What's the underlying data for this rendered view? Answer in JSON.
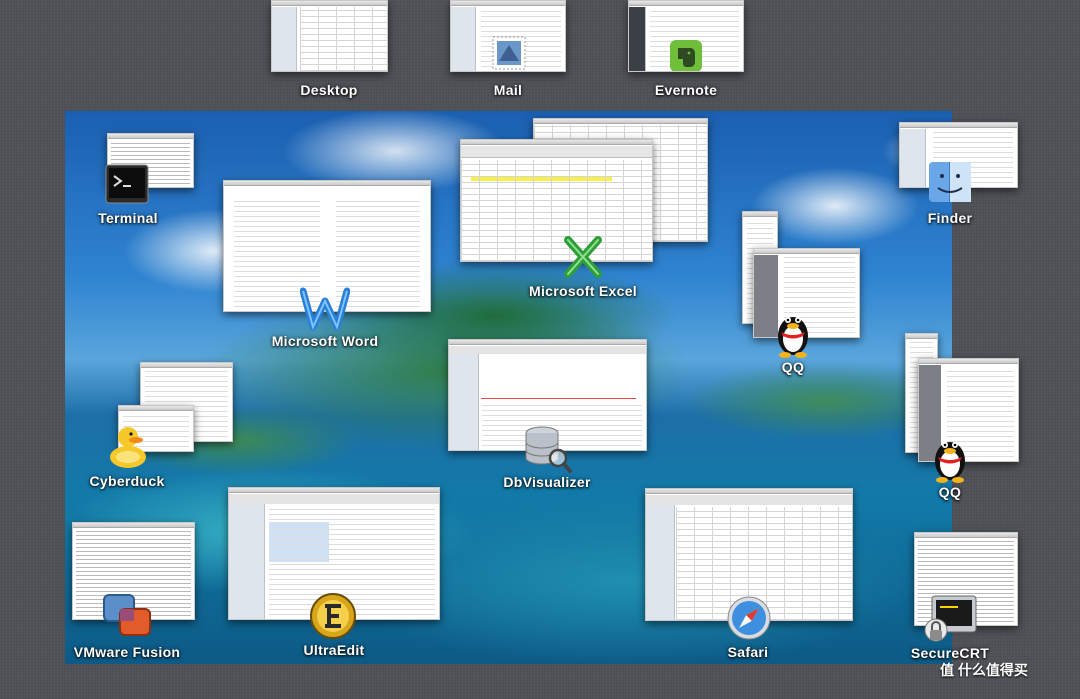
{
  "spaces": [
    {
      "id": "desktop",
      "label": "Desktop"
    },
    {
      "id": "mail",
      "label": "Mail"
    },
    {
      "id": "evernote",
      "label": "Evernote"
    }
  ],
  "apps": {
    "terminal": {
      "label": "Terminal",
      "icon": "terminal-icon"
    },
    "word": {
      "label": "Microsoft Word",
      "icon": "word-icon"
    },
    "excel": {
      "label": "Microsoft Excel",
      "icon": "excel-icon"
    },
    "finder": {
      "label": "Finder",
      "icon": "finder-icon"
    },
    "qq1": {
      "label": "QQ",
      "icon": "qq-penguin-icon"
    },
    "qq2": {
      "label": "QQ",
      "icon": "qq-penguin-icon"
    },
    "dbvis": {
      "label": "DbVisualizer",
      "icon": "database-icon"
    },
    "cyberduck": {
      "label": "Cyberduck",
      "icon": "duck-icon"
    },
    "vmware": {
      "label": "VMware Fusion",
      "icon": "vmware-icon"
    },
    "ultraedit": {
      "label": "UltraEdit",
      "icon": "ultraedit-icon"
    },
    "safari": {
      "label": "Safari",
      "icon": "compass-icon"
    },
    "securecrt": {
      "label": "SecureCRT",
      "icon": "securecrt-icon"
    }
  },
  "watermark": "值 什么值得买",
  "colors": {
    "background": "#4f5257",
    "label": "#ffffff",
    "accent_excel": "#2e9e3a",
    "accent_word": "#2a7fd8"
  }
}
